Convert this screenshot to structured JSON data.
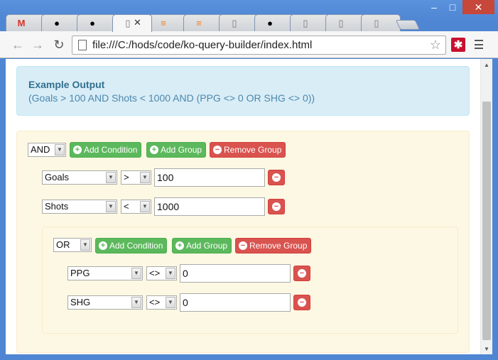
{
  "browser": {
    "url": "file:///C:/hods/code/ko-query-builder/index.html",
    "tab_close_glyph": "✕",
    "window_controls": {
      "minimize": "–",
      "maximize": "□",
      "close": "✕"
    }
  },
  "example_output": {
    "title": "Example Output",
    "expression": "(Goals > 100 AND Shots < 1000 AND (PPG <> 0 OR SHG <> 0))"
  },
  "query": {
    "outer": {
      "operator": "AND",
      "add_condition_label": "Add Condition",
      "add_group_label": "Add Group",
      "remove_group_label": "Remove Group",
      "conditions": [
        {
          "field": "Goals",
          "comparison": ">",
          "value": "100"
        },
        {
          "field": "Shots",
          "comparison": "<",
          "value": "1000"
        }
      ]
    },
    "inner": {
      "operator": "OR",
      "add_condition_label": "Add Condition",
      "add_group_label": "Add Group",
      "remove_group_label": "Remove Group",
      "conditions": [
        {
          "field": "PPG",
          "comparison": "<>",
          "value": "0"
        },
        {
          "field": "SHG",
          "comparison": "<>",
          "value": "0"
        }
      ]
    }
  },
  "icons": {
    "plus": "+",
    "minus": "−",
    "dropdown": "▼"
  },
  "colors": {
    "success": "#5cb85c",
    "danger": "#d9534f",
    "info_bg": "#d9edf7",
    "warning_bg": "#fcf8e3"
  }
}
